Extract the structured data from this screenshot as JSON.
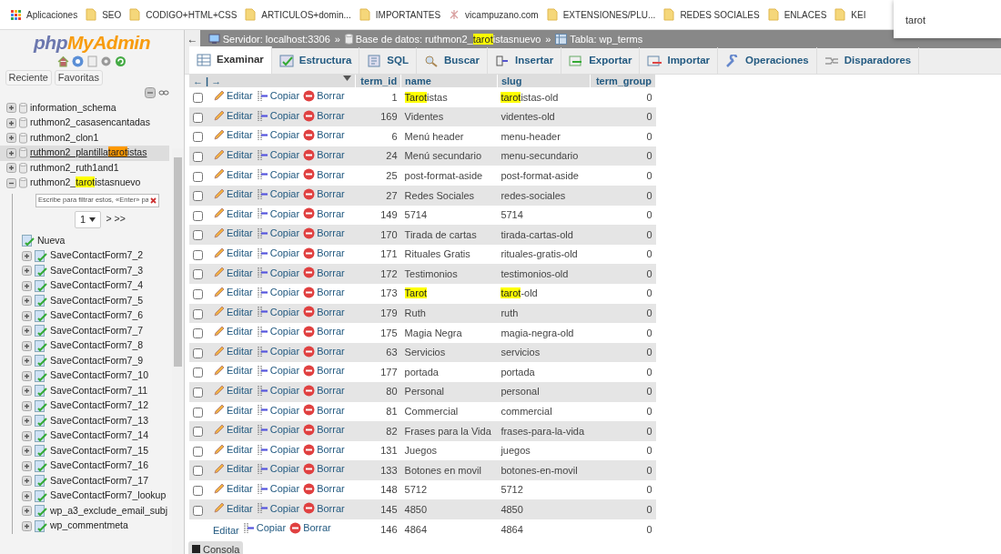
{
  "bookmarks": [
    {
      "kind": "apps",
      "label": "Aplicaciones"
    },
    {
      "kind": "folder",
      "label": "SEO"
    },
    {
      "kind": "folder",
      "label": "CODIGO+HTML+CSS"
    },
    {
      "kind": "folder",
      "label": "ARTICULOS+domin..."
    },
    {
      "kind": "folder",
      "label": "IMPORTANTES"
    },
    {
      "kind": "site",
      "label": "vicampuzano.com"
    },
    {
      "kind": "folder",
      "label": "EXTENSIONES/PLU..."
    },
    {
      "kind": "folder",
      "label": "REDES SOCIALES"
    },
    {
      "kind": "folder",
      "label": "ENLACES"
    },
    {
      "kind": "folder",
      "label": "KEI"
    }
  ],
  "find_popup": {
    "value": "tarot"
  },
  "sidebar": {
    "logo": {
      "part1": "php",
      "part2": "MyAdmin"
    },
    "buttons": [
      "Reciente",
      "Favoritas"
    ],
    "databases": [
      {
        "name": [
          "information_schema"
        ],
        "selected": false,
        "expanded": false
      },
      {
        "name": [
          "ruthmon2_casasencantadas"
        ],
        "selected": false,
        "expanded": false
      },
      {
        "name": [
          "ruthmon2_clon1"
        ],
        "selected": false,
        "expanded": false
      },
      {
        "name": [
          "ruthmon2_plantilla",
          {
            "text": "tarot",
            "highlighted": true,
            "current": true
          },
          "istas"
        ],
        "selected": true,
        "expanded": false
      },
      {
        "name": [
          "ruthmon2_ruth1and1"
        ],
        "selected": false,
        "expanded": false
      },
      {
        "name": [
          "ruthmon2_",
          {
            "text": "tarot",
            "highlighted": true,
            "current": false
          },
          "istasnuevo"
        ],
        "selected": false,
        "expanded": true,
        "filter_placeholder": "Escribe para filtrar estos, «Enter» pa",
        "page": "1",
        "pager_next": "> >>",
        "new_label": "Nueva",
        "tables": [
          "SaveContactForm7_2",
          "SaveContactForm7_3",
          "SaveContactForm7_4",
          "SaveContactForm7_5",
          "SaveContactForm7_6",
          "SaveContactForm7_7",
          "SaveContactForm7_8",
          "SaveContactForm7_9",
          "SaveContactForm7_10",
          "SaveContactForm7_11",
          "SaveContactForm7_12",
          "SaveContactForm7_13",
          "SaveContactForm7_14",
          "SaveContactForm7_15",
          "SaveContactForm7_16",
          "SaveContactForm7_17",
          "SaveContactForm7_lookup",
          "wp_a3_exclude_email_subj",
          "wp_commentmeta"
        ]
      }
    ]
  },
  "breadcrumb": {
    "back": "←",
    "separator": "»",
    "items": [
      {
        "kind": "server",
        "label": [
          "Servidor: localhost:3306"
        ]
      },
      {
        "kind": "database",
        "label": [
          "Base de datos: ruthmon2_",
          {
            "text": "tarot",
            "highlighted": true,
            "current": false
          },
          "istasnuevo"
        ]
      },
      {
        "kind": "table",
        "label": [
          "Tabla: wp_terms"
        ]
      }
    ]
  },
  "tabs": [
    {
      "kind": "browse",
      "label": "Examinar",
      "selected": true
    },
    {
      "kind": "structure",
      "label": "Estructura",
      "selected": false
    },
    {
      "kind": "sql",
      "label": "SQL",
      "selected": false
    },
    {
      "kind": "search",
      "label": "Buscar",
      "selected": false
    },
    {
      "kind": "insert",
      "label": "Insertar",
      "selected": false
    },
    {
      "kind": "export",
      "label": "Exportar",
      "selected": false
    },
    {
      "kind": "import",
      "label": "Importar",
      "selected": false
    },
    {
      "kind": "operations",
      "label": "Operaciones",
      "selected": false
    },
    {
      "kind": "triggers",
      "label": "Disparadores",
      "selected": false
    }
  ],
  "table": {
    "nav_arrows": "← | →",
    "columns": [
      "term_id",
      "name",
      "slug",
      "term_group"
    ],
    "rows": [
      {
        "actions": [
          "Editar",
          "Copiar",
          "Borrar"
        ],
        "term_id": "1",
        "name": [
          {
            "text": "Tarot",
            "highlighted": true,
            "current": false
          },
          "istas"
        ],
        "slug": [
          {
            "text": "tarot",
            "highlighted": true,
            "current": false
          },
          "istas-old"
        ],
        "term_group": "0",
        "checked": false
      },
      {
        "actions": [
          "Editar",
          "Copiar",
          "Borrar"
        ],
        "term_id": "169",
        "name": [
          "Videntes"
        ],
        "slug": [
          "videntes-old"
        ],
        "term_group": "0",
        "checked": false
      },
      {
        "actions": [
          "Editar",
          "Copiar",
          "Borrar"
        ],
        "term_id": "6",
        "name": [
          "Menú header"
        ],
        "slug": [
          "menu-header"
        ],
        "term_group": "0",
        "checked": false
      },
      {
        "actions": [
          "Editar",
          "Copiar",
          "Borrar"
        ],
        "term_id": "24",
        "name": [
          "Menú secundario"
        ],
        "slug": [
          "menu-secundario"
        ],
        "term_group": "0",
        "checked": false
      },
      {
        "actions": [
          "Editar",
          "Copiar",
          "Borrar"
        ],
        "term_id": "25",
        "name": [
          "post-format-aside"
        ],
        "slug": [
          "post-format-aside"
        ],
        "term_group": "0",
        "checked": false
      },
      {
        "actions": [
          "Editar",
          "Copiar",
          "Borrar"
        ],
        "term_id": "27",
        "name": [
          "Redes Sociales"
        ],
        "slug": [
          "redes-sociales"
        ],
        "term_group": "0",
        "checked": false
      },
      {
        "actions": [
          "Editar",
          "Copiar",
          "Borrar"
        ],
        "term_id": "149",
        "name": [
          "5714"
        ],
        "slug": [
          "5714"
        ],
        "term_group": "0",
        "checked": false
      },
      {
        "actions": [
          "Editar",
          "Copiar",
          "Borrar"
        ],
        "term_id": "170",
        "name": [
          "Tirada de cartas"
        ],
        "slug": [
          "tirada-cartas-old"
        ],
        "term_group": "0",
        "checked": false
      },
      {
        "actions": [
          "Editar",
          "Copiar",
          "Borrar"
        ],
        "term_id": "171",
        "name": [
          "Rituales Gratis"
        ],
        "slug": [
          "rituales-gratis-old"
        ],
        "term_group": "0",
        "checked": false
      },
      {
        "actions": [
          "Editar",
          "Copiar",
          "Borrar"
        ],
        "term_id": "172",
        "name": [
          "Testimonios"
        ],
        "slug": [
          "testimonios-old"
        ],
        "term_group": "0",
        "checked": false
      },
      {
        "actions": [
          "Editar",
          "Copiar",
          "Borrar"
        ],
        "term_id": "173",
        "name": [
          {
            "text": "Tarot",
            "highlighted": true,
            "current": false
          }
        ],
        "slug": [
          {
            "text": "tarot",
            "highlighted": true,
            "current": false
          },
          "-old"
        ],
        "term_group": "0",
        "checked": false
      },
      {
        "actions": [
          "Editar",
          "Copiar",
          "Borrar"
        ],
        "term_id": "179",
        "name": [
          "Ruth"
        ],
        "slug": [
          "ruth"
        ],
        "term_group": "0",
        "checked": false
      },
      {
        "actions": [
          "Editar",
          "Copiar",
          "Borrar"
        ],
        "term_id": "175",
        "name": [
          "Magia Negra"
        ],
        "slug": [
          "magia-negra-old"
        ],
        "term_group": "0",
        "checked": false
      },
      {
        "actions": [
          "Editar",
          "Copiar",
          "Borrar"
        ],
        "term_id": "63",
        "name": [
          "Servicios"
        ],
        "slug": [
          "servicios"
        ],
        "term_group": "0",
        "checked": false
      },
      {
        "actions": [
          "Editar",
          "Copiar",
          "Borrar"
        ],
        "term_id": "177",
        "name": [
          "portada"
        ],
        "slug": [
          "portada"
        ],
        "term_group": "0",
        "checked": false
      },
      {
        "actions": [
          "Editar",
          "Copiar",
          "Borrar"
        ],
        "term_id": "80",
        "name": [
          "Personal"
        ],
        "slug": [
          "personal"
        ],
        "term_group": "0",
        "checked": false
      },
      {
        "actions": [
          "Editar",
          "Copiar",
          "Borrar"
        ],
        "term_id": "81",
        "name": [
          "Commercial"
        ],
        "slug": [
          "commercial"
        ],
        "term_group": "0",
        "checked": false
      },
      {
        "actions": [
          "Editar",
          "Copiar",
          "Borrar"
        ],
        "term_id": "82",
        "name": [
          "Frases para la Vida"
        ],
        "slug": [
          "frases-para-la-vida"
        ],
        "term_group": "0",
        "checked": false
      },
      {
        "actions": [
          "Editar",
          "Copiar",
          "Borrar"
        ],
        "term_id": "131",
        "name": [
          "Juegos"
        ],
        "slug": [
          "juegos"
        ],
        "term_group": "0",
        "checked": false
      },
      {
        "actions": [
          "Editar",
          "Copiar",
          "Borrar"
        ],
        "term_id": "133",
        "name": [
          "Botones en movil"
        ],
        "slug": [
          "botones-en-movil"
        ],
        "term_group": "0",
        "checked": false
      },
      {
        "actions": [
          "Editar",
          "Copiar",
          "Borrar"
        ],
        "term_id": "148",
        "name": [
          "5712"
        ],
        "slug": [
          "5712"
        ],
        "term_group": "0",
        "checked": false
      },
      {
        "actions": [
          "Editar",
          "Copiar",
          "Borrar"
        ],
        "term_id": "145",
        "name": [
          "4850"
        ],
        "slug": [
          "4850"
        ],
        "term_group": "0",
        "checked": false
      },
      {
        "actions": [
          "Editar",
          "Copiar",
          "Borrar"
        ],
        "term_id": "146",
        "name": [
          "4864"
        ],
        "slug": [
          "4864"
        ],
        "term_group": "0",
        "covered": true
      }
    ]
  },
  "console": {
    "label": "Consola"
  }
}
